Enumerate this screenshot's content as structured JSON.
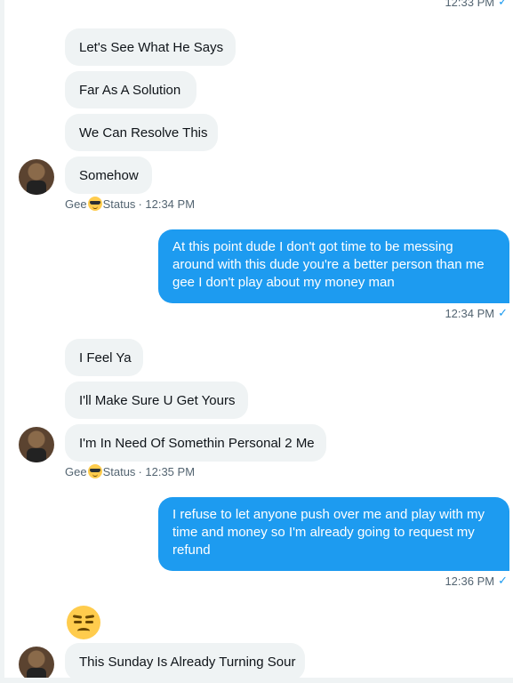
{
  "top_meta": {
    "time": "12:33 PM"
  },
  "group1": {
    "messages": [
      "Let's See What He Says",
      "Far As A Solution",
      "We Can Resolve This",
      "Somehow"
    ],
    "sender_name_start": "Gee",
    "sender_name_end": "Status",
    "time": "· 12:34 PM"
  },
  "out1": {
    "text": "At this point dude I don't got time to be messing around with this dude you're a better person than me gee I don't play about my money man",
    "time": "12:34 PM"
  },
  "group2": {
    "messages": [
      "I Feel Ya",
      "I'll Make Sure U Get Yours",
      "I'm In Need Of Somethin Personal 2 Me"
    ],
    "sender_name_start": "Gee",
    "sender_name_end": "Status",
    "time": "· 12:35 PM"
  },
  "out2": {
    "text": "I refuse to let anyone push over me and play with my time and money so I'm already going to request my refund",
    "time": "12:36 PM"
  },
  "group3": {
    "emoji": "unamused-face-emoji",
    "messages": [
      "This Sunday Is Already Turning Sour"
    ]
  },
  "colors": {
    "incoming_bubble": "#eff3f4",
    "outgoing_bubble": "#1d9bf0",
    "meta_text": "#536471",
    "check": "#1d9bf0"
  },
  "icons": {
    "read_receipt": "check-icon",
    "sender_emoji": "sunglasses-emoji-icon"
  }
}
